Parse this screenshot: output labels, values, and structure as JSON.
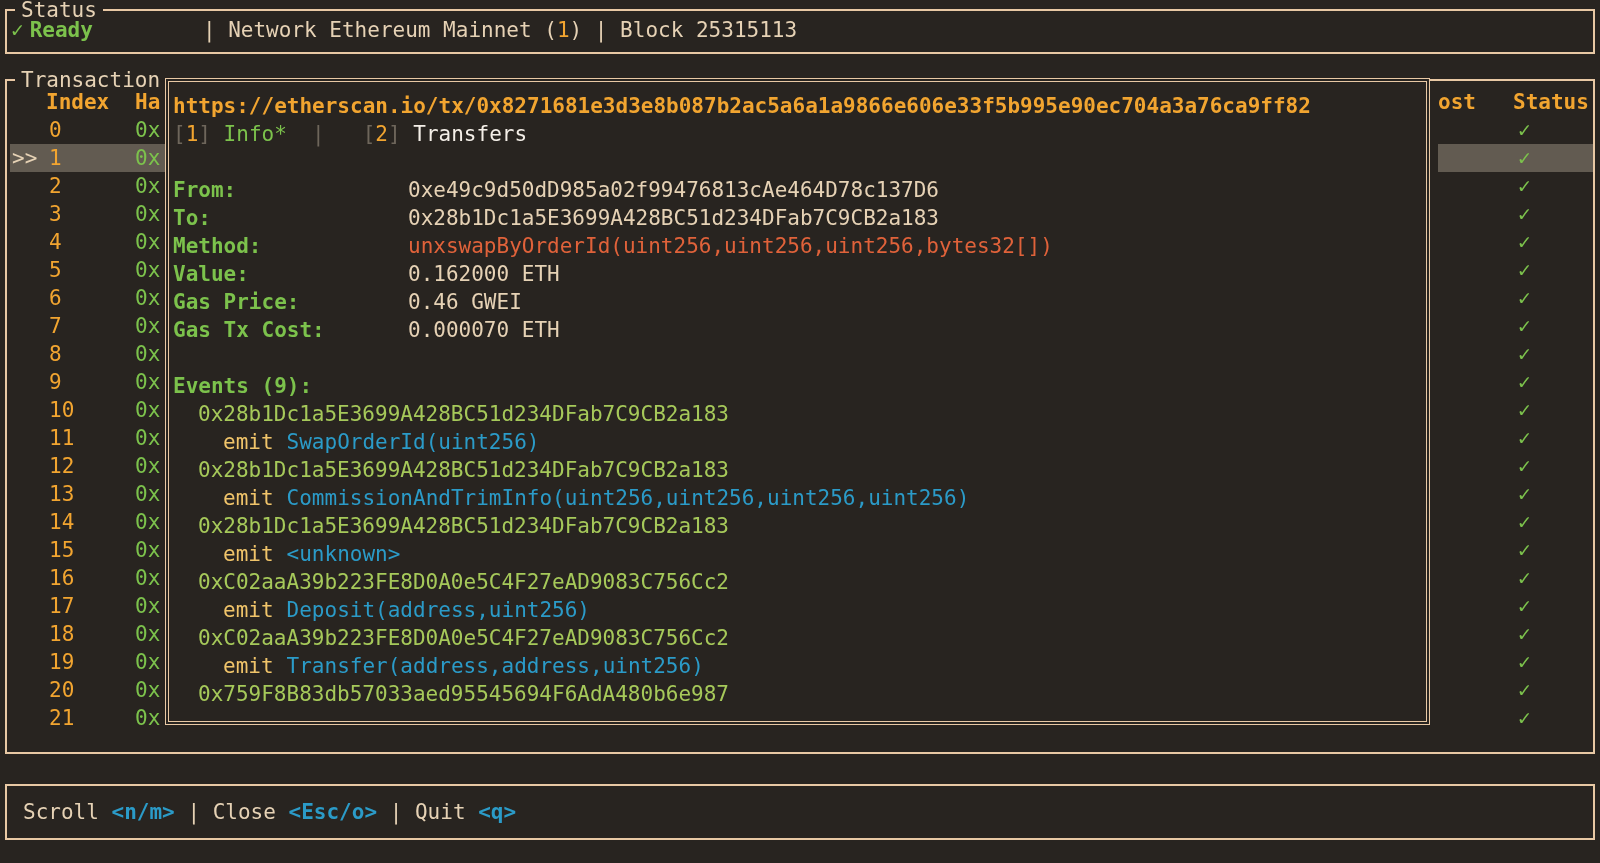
{
  "status": {
    "title": "Status",
    "check": "✓",
    "state": "Ready",
    "segments": [
      {
        "kind": "plain",
        "text": "| Network Ethereum Mainnet ("
      },
      {
        "kind": "accent",
        "text": "1"
      },
      {
        "kind": "plain",
        "text": ") | Block 25315113"
      }
    ]
  },
  "transactions": {
    "title": "Transaction",
    "cursor": ">>",
    "columns": {
      "index": "Index",
      "hash": "Ha",
      "cost": "ost",
      "status": "Status"
    },
    "rows": [
      {
        "index": "0",
        "hash": "0x",
        "status": "✓",
        "selected": false
      },
      {
        "index": "1",
        "hash": "0x",
        "status": "✓",
        "selected": true
      },
      {
        "index": "2",
        "hash": "0x",
        "status": "✓",
        "selected": false
      },
      {
        "index": "3",
        "hash": "0x",
        "status": "✓",
        "selected": false
      },
      {
        "index": "4",
        "hash": "0x",
        "status": "✓",
        "selected": false
      },
      {
        "index": "5",
        "hash": "0x",
        "status": "✓",
        "selected": false
      },
      {
        "index": "6",
        "hash": "0x",
        "status": "✓",
        "selected": false
      },
      {
        "index": "7",
        "hash": "0x",
        "status": "✓",
        "selected": false
      },
      {
        "index": "8",
        "hash": "0x",
        "status": "✓",
        "selected": false
      },
      {
        "index": "9",
        "hash": "0x",
        "status": "✓",
        "selected": false
      },
      {
        "index": "10",
        "hash": "0x",
        "status": "✓",
        "selected": false
      },
      {
        "index": "11",
        "hash": "0x",
        "status": "✓",
        "selected": false
      },
      {
        "index": "12",
        "hash": "0x",
        "status": "✓",
        "selected": false
      },
      {
        "index": "13",
        "hash": "0x",
        "status": "✓",
        "selected": false
      },
      {
        "index": "14",
        "hash": "0x",
        "status": "✓",
        "selected": false
      },
      {
        "index": "15",
        "hash": "0x",
        "status": "✓",
        "selected": false
      },
      {
        "index": "16",
        "hash": "0x",
        "status": "✓",
        "selected": false
      },
      {
        "index": "17",
        "hash": "0x",
        "status": "✓",
        "selected": false
      },
      {
        "index": "18",
        "hash": "0x",
        "status": "✓",
        "selected": false
      },
      {
        "index": "19",
        "hash": "0x",
        "status": "✓",
        "selected": false
      },
      {
        "index": "20",
        "hash": "0x",
        "status": "✓",
        "selected": false
      },
      {
        "index": "21",
        "hash": "0x",
        "status": "✓",
        "selected": false
      }
    ]
  },
  "detail": {
    "url": "https://etherscan.io/tx/0x8271681e3d3e8b087b2ac5a6a1a9866e606e33f5b995e90ec704a3a76ca9ff82",
    "tabs": {
      "open": "[",
      "close": "]",
      "separator": "|",
      "items": [
        {
          "key": "1",
          "label": "Info*",
          "selected": true
        },
        {
          "key": "2",
          "label": "Transfers",
          "selected": false
        }
      ]
    },
    "fields": [
      {
        "label": "From:",
        "value": "0xe49c9d50dD985a02f99476813cAe464D78c137D6",
        "kind": "plain"
      },
      {
        "label": "To:",
        "value": "0x28b1Dc1a5E3699A428BC51d234DFab7C9CB2a183",
        "kind": "plain"
      },
      {
        "label": "Method:",
        "value": "unxswapByOrderId(uint256,uint256,uint256,bytes32[])",
        "kind": "method"
      },
      {
        "label": "Value:",
        "value": "0.162000 ETH",
        "kind": "plain"
      },
      {
        "label": "Gas Price:",
        "value": "0.46 GWEI",
        "kind": "plain"
      },
      {
        "label": "Gas Tx Cost:",
        "value": "0.000070 ETH",
        "kind": "plain"
      }
    ],
    "events_title": "Events (9):",
    "events": [
      {
        "address": "0x28b1Dc1a5E3699A428BC51d234DFab7C9CB2a183",
        "keyword": "emit",
        "signature": "SwapOrderId(uint256)"
      },
      {
        "address": "0x28b1Dc1a5E3699A428BC51d234DFab7C9CB2a183",
        "keyword": "emit",
        "signature": "CommissionAndTrimInfo(uint256,uint256,uint256,uint256)"
      },
      {
        "address": "0x28b1Dc1a5E3699A428BC51d234DFab7C9CB2a183",
        "keyword": "emit",
        "signature": "<unknown>"
      },
      {
        "address": "0xC02aaA39b223FE8D0A0e5C4F27eAD9083C756Cc2",
        "keyword": "emit",
        "signature": "Deposit(address,uint256)"
      },
      {
        "address": "0xC02aaA39b223FE8D0A0e5C4F27eAD9083C756Cc2",
        "keyword": "emit",
        "signature": "Transfer(address,address,uint256)"
      },
      {
        "address": "0x759F8B83db57033aed95545694F6AdA480b6e987"
      }
    ]
  },
  "footer": [
    {
      "kind": "plain",
      "text": "Scroll "
    },
    {
      "kind": "key",
      "text": "<n/m>"
    },
    {
      "kind": "plain",
      "text": " | Close "
    },
    {
      "kind": "key",
      "text": "<Esc/o>"
    },
    {
      "kind": "plain",
      "text": " | Quit "
    },
    {
      "kind": "key",
      "text": "<q>"
    }
  ]
}
